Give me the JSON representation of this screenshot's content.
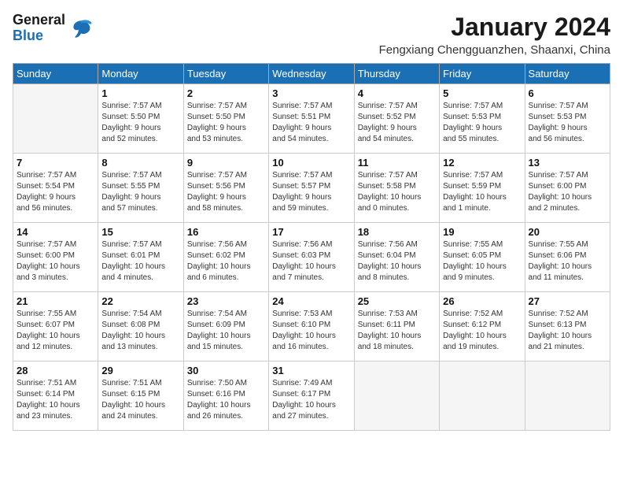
{
  "header": {
    "logo": {
      "line1": "General",
      "line2": "Blue"
    },
    "title": "January 2024",
    "location": "Fengxiang Chengguanzhen, Shaanxi, China"
  },
  "calendar": {
    "days_of_week": [
      "Sunday",
      "Monday",
      "Tuesday",
      "Wednesday",
      "Thursday",
      "Friday",
      "Saturday"
    ],
    "weeks": [
      [
        {
          "day": "",
          "info": ""
        },
        {
          "day": "1",
          "info": "Sunrise: 7:57 AM\nSunset: 5:50 PM\nDaylight: 9 hours\nand 52 minutes."
        },
        {
          "day": "2",
          "info": "Sunrise: 7:57 AM\nSunset: 5:50 PM\nDaylight: 9 hours\nand 53 minutes."
        },
        {
          "day": "3",
          "info": "Sunrise: 7:57 AM\nSunset: 5:51 PM\nDaylight: 9 hours\nand 54 minutes."
        },
        {
          "day": "4",
          "info": "Sunrise: 7:57 AM\nSunset: 5:52 PM\nDaylight: 9 hours\nand 54 minutes."
        },
        {
          "day": "5",
          "info": "Sunrise: 7:57 AM\nSunset: 5:53 PM\nDaylight: 9 hours\nand 55 minutes."
        },
        {
          "day": "6",
          "info": "Sunrise: 7:57 AM\nSunset: 5:53 PM\nDaylight: 9 hours\nand 56 minutes."
        }
      ],
      [
        {
          "day": "7",
          "info": "Sunrise: 7:57 AM\nSunset: 5:54 PM\nDaylight: 9 hours\nand 56 minutes."
        },
        {
          "day": "8",
          "info": "Sunrise: 7:57 AM\nSunset: 5:55 PM\nDaylight: 9 hours\nand 57 minutes."
        },
        {
          "day": "9",
          "info": "Sunrise: 7:57 AM\nSunset: 5:56 PM\nDaylight: 9 hours\nand 58 minutes."
        },
        {
          "day": "10",
          "info": "Sunrise: 7:57 AM\nSunset: 5:57 PM\nDaylight: 9 hours\nand 59 minutes."
        },
        {
          "day": "11",
          "info": "Sunrise: 7:57 AM\nSunset: 5:58 PM\nDaylight: 10 hours\nand 0 minutes."
        },
        {
          "day": "12",
          "info": "Sunrise: 7:57 AM\nSunset: 5:59 PM\nDaylight: 10 hours\nand 1 minute."
        },
        {
          "day": "13",
          "info": "Sunrise: 7:57 AM\nSunset: 6:00 PM\nDaylight: 10 hours\nand 2 minutes."
        }
      ],
      [
        {
          "day": "14",
          "info": "Sunrise: 7:57 AM\nSunset: 6:00 PM\nDaylight: 10 hours\nand 3 minutes."
        },
        {
          "day": "15",
          "info": "Sunrise: 7:57 AM\nSunset: 6:01 PM\nDaylight: 10 hours\nand 4 minutes."
        },
        {
          "day": "16",
          "info": "Sunrise: 7:56 AM\nSunset: 6:02 PM\nDaylight: 10 hours\nand 6 minutes."
        },
        {
          "day": "17",
          "info": "Sunrise: 7:56 AM\nSunset: 6:03 PM\nDaylight: 10 hours\nand 7 minutes."
        },
        {
          "day": "18",
          "info": "Sunrise: 7:56 AM\nSunset: 6:04 PM\nDaylight: 10 hours\nand 8 minutes."
        },
        {
          "day": "19",
          "info": "Sunrise: 7:55 AM\nSunset: 6:05 PM\nDaylight: 10 hours\nand 9 minutes."
        },
        {
          "day": "20",
          "info": "Sunrise: 7:55 AM\nSunset: 6:06 PM\nDaylight: 10 hours\nand 11 minutes."
        }
      ],
      [
        {
          "day": "21",
          "info": "Sunrise: 7:55 AM\nSunset: 6:07 PM\nDaylight: 10 hours\nand 12 minutes."
        },
        {
          "day": "22",
          "info": "Sunrise: 7:54 AM\nSunset: 6:08 PM\nDaylight: 10 hours\nand 13 minutes."
        },
        {
          "day": "23",
          "info": "Sunrise: 7:54 AM\nSunset: 6:09 PM\nDaylight: 10 hours\nand 15 minutes."
        },
        {
          "day": "24",
          "info": "Sunrise: 7:53 AM\nSunset: 6:10 PM\nDaylight: 10 hours\nand 16 minutes."
        },
        {
          "day": "25",
          "info": "Sunrise: 7:53 AM\nSunset: 6:11 PM\nDaylight: 10 hours\nand 18 minutes."
        },
        {
          "day": "26",
          "info": "Sunrise: 7:52 AM\nSunset: 6:12 PM\nDaylight: 10 hours\nand 19 minutes."
        },
        {
          "day": "27",
          "info": "Sunrise: 7:52 AM\nSunset: 6:13 PM\nDaylight: 10 hours\nand 21 minutes."
        }
      ],
      [
        {
          "day": "28",
          "info": "Sunrise: 7:51 AM\nSunset: 6:14 PM\nDaylight: 10 hours\nand 23 minutes."
        },
        {
          "day": "29",
          "info": "Sunrise: 7:51 AM\nSunset: 6:15 PM\nDaylight: 10 hours\nand 24 minutes."
        },
        {
          "day": "30",
          "info": "Sunrise: 7:50 AM\nSunset: 6:16 PM\nDaylight: 10 hours\nand 26 minutes."
        },
        {
          "day": "31",
          "info": "Sunrise: 7:49 AM\nSunset: 6:17 PM\nDaylight: 10 hours\nand 27 minutes."
        },
        {
          "day": "",
          "info": ""
        },
        {
          "day": "",
          "info": ""
        },
        {
          "day": "",
          "info": ""
        }
      ]
    ]
  }
}
